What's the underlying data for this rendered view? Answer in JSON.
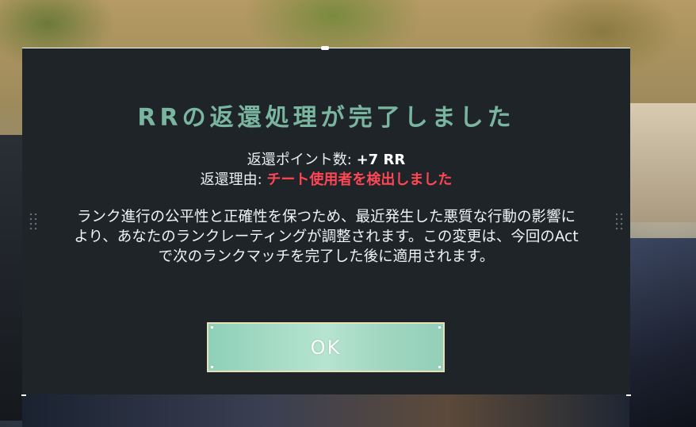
{
  "dialog": {
    "title": "RRの返還処理が完了しました",
    "refund_points_label": "返還ポイント数: ",
    "refund_points_value": "+7 RR",
    "refund_reason_label": "返還理由: ",
    "refund_reason_value": "チート使用者を検出しました",
    "description": "ランク進行の公平性と正確性を保つため、最近発生した悪質な行動の影響により、あなたのランクレーティングが調整されます。この変更は、今回のActで次のランクマッチを完了した後に適用されます。",
    "ok_button_label": "OK"
  },
  "colors": {
    "title": "#79b59f",
    "reason": "#ff4655",
    "button": "#a7dcc7",
    "modal_bg": "#1e2428"
  }
}
